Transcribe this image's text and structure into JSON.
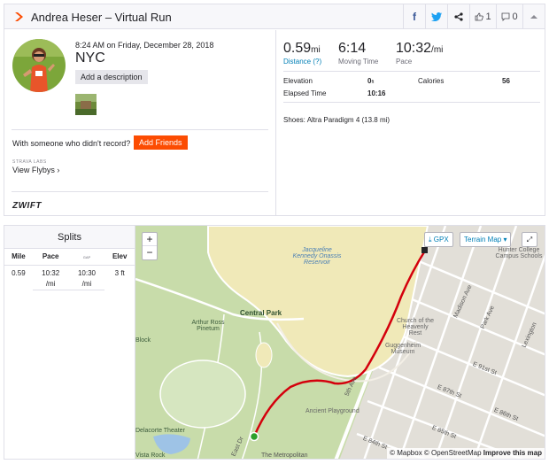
{
  "header": {
    "title": "Andrea Heser – Virtual Run",
    "kudos_count": "1",
    "comment_count": "0"
  },
  "activity": {
    "datetime": "8:24 AM on Friday, December 28, 2018",
    "name": "NYC",
    "add_description_label": "Add a description",
    "someone_text": "With someone who didn't record?",
    "add_friends_label": "Add Friends",
    "labs_label": "STRAVA LABS",
    "flybys_label": "View Flybys ›",
    "zwift_label": "ZWIFT"
  },
  "stats": {
    "distance_value": "0.59",
    "distance_unit": "mi",
    "distance_label": "Distance (?)",
    "moving_time_value": "6:14",
    "moving_time_label": "Moving Time",
    "pace_value": "10:32",
    "pace_unit": "/mi",
    "pace_label": "Pace",
    "elevation_label": "Elevation",
    "elevation_value": "0",
    "elevation_unit": "ft",
    "calories_label": "Calories",
    "calories_value": "56",
    "elapsed_label": "Elapsed Time",
    "elapsed_value": "10:16",
    "shoes_text": "Shoes: Altra Paradigm 4 (13.8 mi)"
  },
  "splits": {
    "title": "Splits",
    "col_mile": "Mile",
    "col_pace": "Pace",
    "col_gap_small": "GAP",
    "col_elev": "Elev",
    "row": {
      "mile": "0.59",
      "pace": "10:32",
      "pace_unit": "/mi",
      "gap": "10:30",
      "gap_unit": "/mi",
      "elev": "3 ft"
    }
  },
  "map": {
    "zoom_in": "+",
    "zoom_out": "−",
    "gpx_label": "⤓ GPX",
    "terrain_label": "Terrain Map ▾",
    "fullscreen": "⤢",
    "labels": {
      "reservoir": "Jacqueline Kennedy Onassis Reservoir",
      "central_park": "Central Park",
      "arthur_ross": "Arthur Ross Pinetum",
      "fifth_ave": "5th Ave",
      "madison_ave": "Madison Ave",
      "park_ave": "Park Ave",
      "lexington": "Lexington",
      "hunter": "Hunter College Campus Schools",
      "church": "Church of the Heavenly Rest",
      "guggenheim": "Guggenheim Museum",
      "e91": "E 91st St",
      "e87": "E 87th St",
      "e86": "E 86th St",
      "e84": "E 84th St",
      "e85": "E 85th St",
      "ancient": "Ancient Playground",
      "delacorte": "Delacorte Theater",
      "vista": "Vista Rock",
      "block": "Block",
      "east_dr": "East Dr",
      "metropolitan": "The Metropolitan"
    },
    "attribution_mapbox": "© Mapbox",
    "attribution_osm": "© OpenStreetMap",
    "attribution_improve": "Improve this map"
  },
  "colors": {
    "brand": "#fc4c02",
    "link": "#007fb6",
    "route": "#d4000c",
    "park": "#c8dcaa",
    "reservoir": "#f0e9b8",
    "street": "#e6e3dd"
  }
}
